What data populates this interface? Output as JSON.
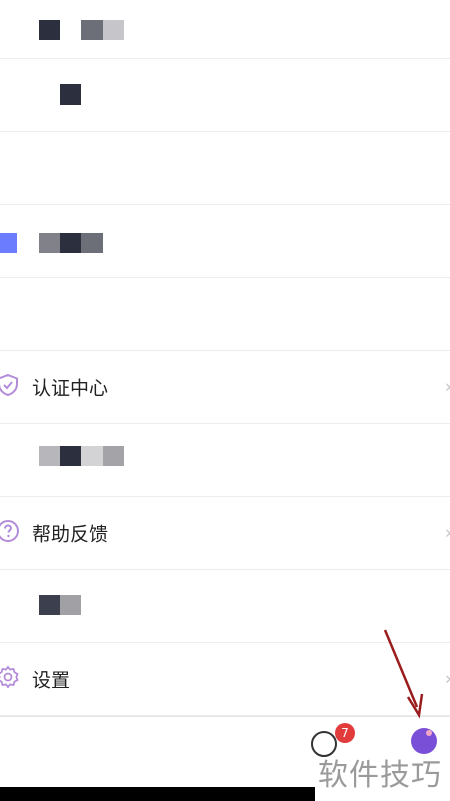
{
  "menu": {
    "items": [
      {
        "label": "认证中心",
        "icon": "shield-check-icon"
      },
      {
        "label": "帮助反馈",
        "icon": "question-circle-icon"
      },
      {
        "label": "设置",
        "icon": "gear-icon"
      }
    ],
    "chevron": "›"
  },
  "tabbar": {
    "badge_count": "7"
  },
  "watermark": "软件技巧",
  "colors": {
    "accent": "#6b7cff",
    "badge": "#e23b3b",
    "arrow": "#9b1c1c",
    "icon_purple": "#b38cd9"
  }
}
